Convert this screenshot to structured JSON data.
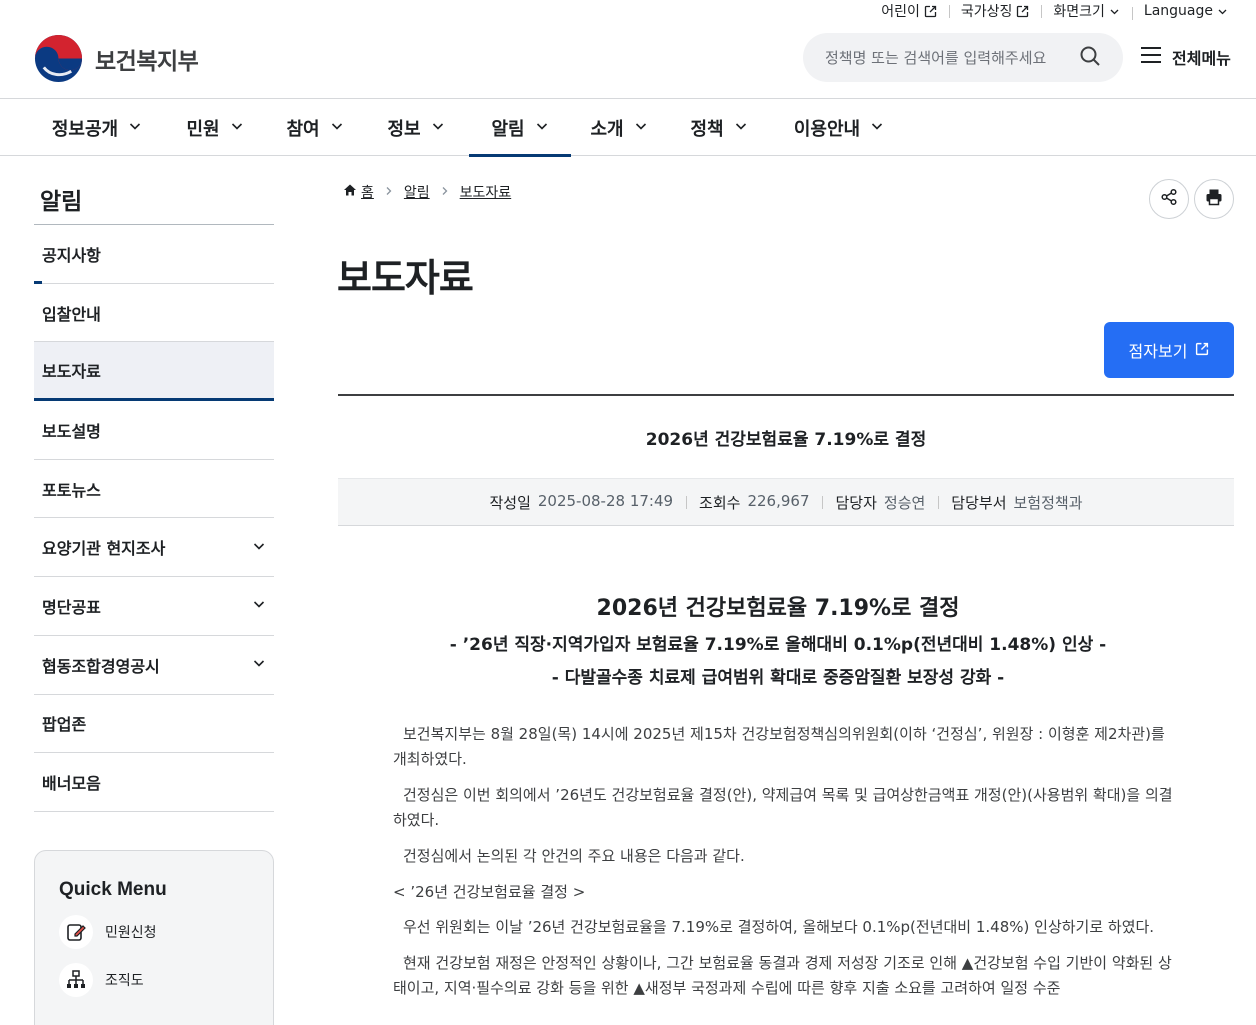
{
  "util": {
    "kids": "어린이",
    "national_symbol": "국가상징",
    "screen_size": "화면크기",
    "language": "Language"
  },
  "header": {
    "logo_text": "보건복지부",
    "search_placeholder": "정책명 또는 검색어를 입력해주세요",
    "all_menu": "전체메뉴"
  },
  "gnb": [
    "정보공개",
    "민원",
    "참여",
    "정보",
    "알림",
    "소개",
    "정책",
    "이용안내"
  ],
  "sidebar": {
    "title": "알림",
    "items": [
      {
        "label": "공지사항"
      },
      {
        "label": "입찰안내"
      },
      {
        "label": "보도자료"
      },
      {
        "label": "보도설명"
      },
      {
        "label": "포토뉴스"
      },
      {
        "label": "요양기관 현지조사"
      },
      {
        "label": "명단공표"
      },
      {
        "label": "협동조합경영공시"
      },
      {
        "label": "팝업존"
      },
      {
        "label": "배너모음"
      }
    ]
  },
  "quick_menu": {
    "title": "Quick Menu",
    "items": [
      {
        "label": "민원신청"
      },
      {
        "label": "조직도"
      }
    ]
  },
  "breadcrumb": [
    "홈",
    "알림",
    "보도자료"
  ],
  "page_title": "보도자료",
  "braille_button": "점자보기",
  "article": {
    "title": "2026년 건강보험료율 7.19%로 결정",
    "meta": [
      {
        "key": "작성일",
        "value": "2025-08-28 17:49"
      },
      {
        "key": "조회수",
        "value": "226,967"
      },
      {
        "key": "담당자",
        "value": "정승연"
      },
      {
        "key": "담당부서",
        "value": "보험정책과"
      }
    ],
    "headline": "2026년 건강보험료율 7.19%로 결정",
    "sub1": "- ’26년 직장·지역가입자 보험료율 7.19%로 올해대비 0.1%p(전년대비 1.48%) 인상 -",
    "sub2": "- 다발골수종 치료제 급여범위 확대로 중증암질환 보장성 강화 -",
    "paragraphs": [
      "보건복지부는 8월 28일(목) 14시에 2025년 제15차 건강보험정책심의위원회(이하 ‘건정심’, 위원장 : 이형훈 제2차관)를 개최하였다.",
      "건정심은 이번 회의에서 ’26년도 건강보험료율 결정(안), 약제급여 목록 및 급여상한금액표 개정(안)(사용범위 확대)을 의결하였다.",
      "건정심에서 논의된 각 안건의 주요 내용은 다음과 같다.",
      "< ’26년 건강보험료율 결정 >",
      "우선 위원회는 이날 ’26년 건강보험료율을 7.19%로 결정하여, 올해보다 0.1%p(전년대비 1.48%) 인상하기로 하였다.",
      "현재 건강보험 재정은 안정적인 상황이나, 그간 보험료율 동결과 경제 저성장 기조로 인해 ▲건강보험 수입 기반이 약화된 상태이고, 지역·필수의료 강화 등을 위한 ▲새정부 국정과제 수립에 따른 향후 지출 소요를 고려하여 일정 수준"
    ]
  }
}
